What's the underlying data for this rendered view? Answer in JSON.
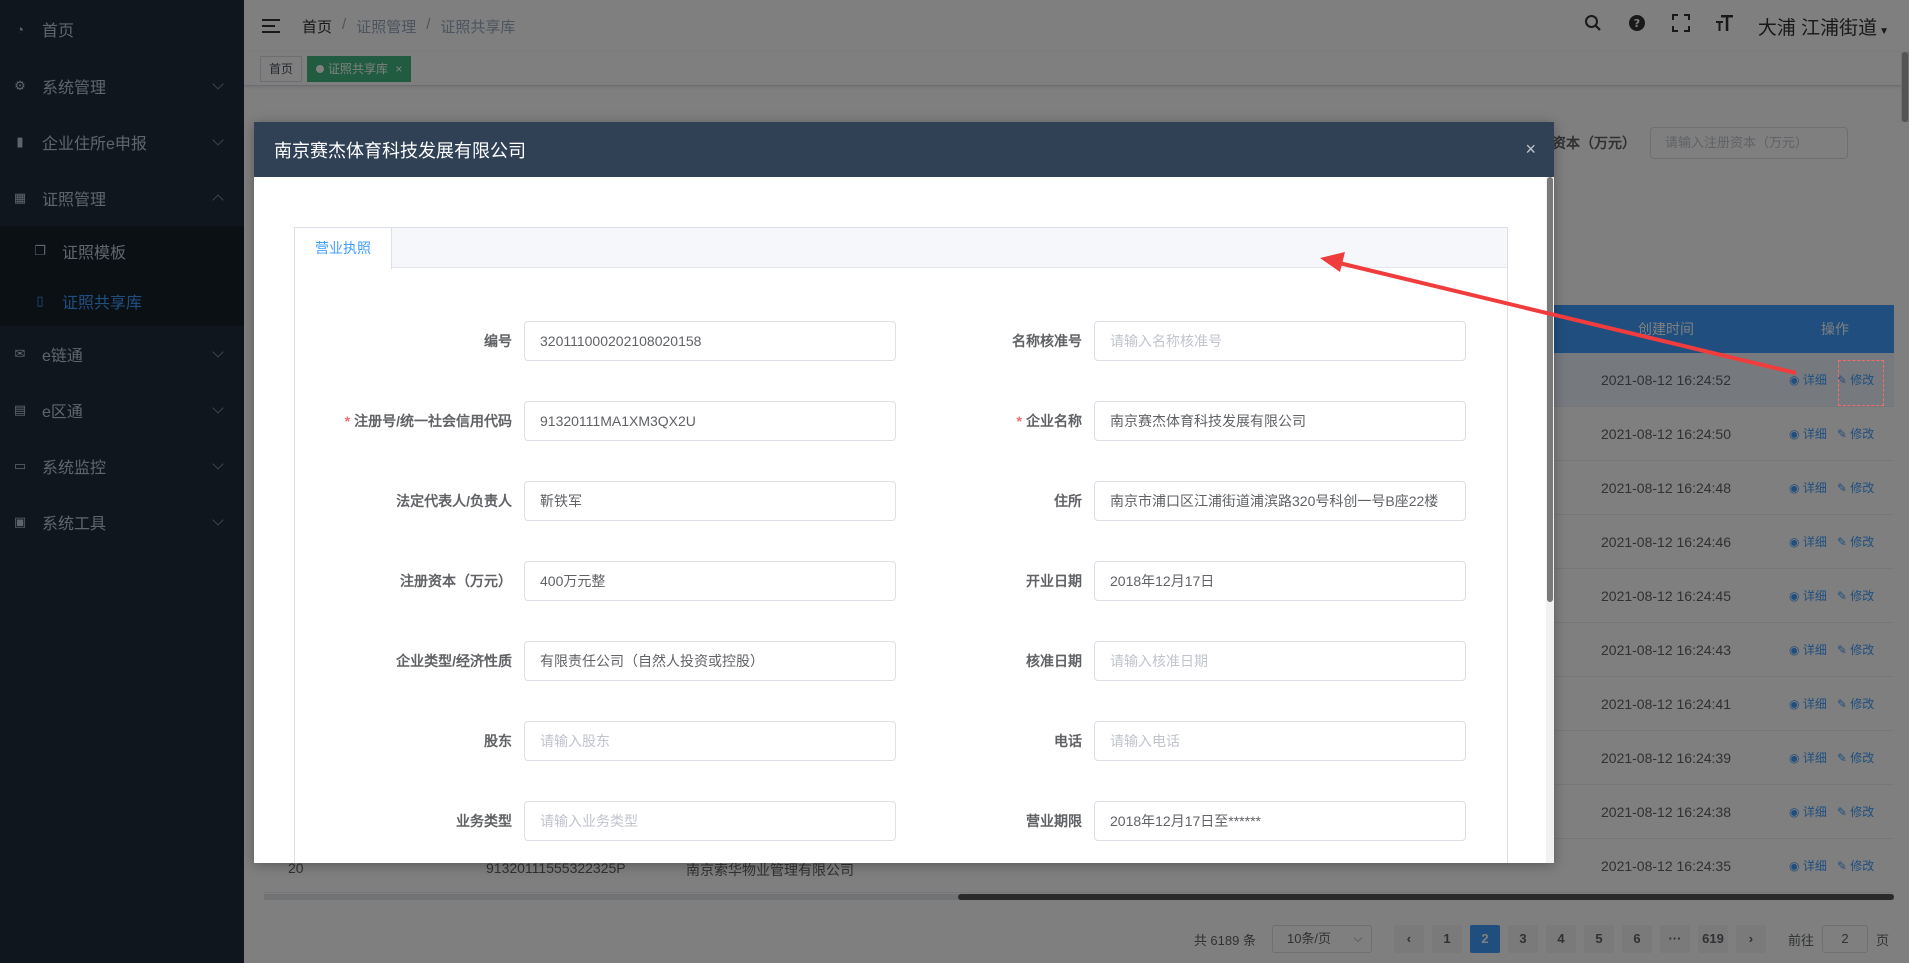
{
  "sidebar": {
    "items": [
      {
        "label": "首页",
        "icon": "dashboard-icon"
      },
      {
        "label": "系统管理",
        "icon": "gear-icon"
      },
      {
        "label": "企业住所e申报",
        "icon": "book-icon"
      },
      {
        "label": "证照管理",
        "icon": "grid-icon"
      },
      {
        "label": "e链通",
        "icon": "mail-icon"
      },
      {
        "label": "e区通",
        "icon": "document-icon"
      },
      {
        "label": "系统监控",
        "icon": "monitor-icon"
      },
      {
        "label": "系统工具",
        "icon": "toolbox-icon"
      }
    ],
    "submenu": [
      {
        "label": "证照模板",
        "icon": "copy-icon"
      },
      {
        "label": "证照共享库",
        "icon": "open-book-icon"
      }
    ]
  },
  "navbar": {
    "breadcrumb": [
      "首页",
      "证照管理",
      "证照共享库"
    ],
    "separator": "/",
    "user": "大浦  江浦街道"
  },
  "tags": {
    "home": "首页",
    "active": "证照共享库",
    "close": "×"
  },
  "background": {
    "filter_label": "资本（万元）",
    "filter_placeholder": "请输入注册资本（万元）",
    "table_headers": {
      "time": "创建时间",
      "ops": "操作"
    },
    "rows": [
      {
        "time": "2021-08-12 16:24:52"
      },
      {
        "time": "2021-08-12 16:24:50"
      },
      {
        "time": "2021-08-12 16:24:48"
      },
      {
        "time": "2021-08-12 16:24:46"
      },
      {
        "time": "2021-08-12 16:24:45"
      },
      {
        "time": "2021-08-12 16:24:43"
      },
      {
        "time": "2021-08-12 16:24:41"
      },
      {
        "time": "2021-08-12 16:24:39"
      },
      {
        "time": "2021-08-12 16:24:38"
      },
      {
        "time": "2021-08-12 16:24:35"
      }
    ],
    "op_detail": "详细",
    "op_edit": "修改",
    "last_row": {
      "index": "20",
      "code": "91320111555322325P",
      "name": "南京索华物业管理有限公司"
    },
    "pagination": {
      "total": "共 6189 条",
      "page_size": "10条/页",
      "pages": [
        "1",
        "2",
        "3",
        "4",
        "5",
        "6",
        "···",
        "619"
      ],
      "current": "2",
      "prev": "‹",
      "next": "›",
      "goto_prefix": "前往",
      "goto_value": "2",
      "goto_suffix": "页"
    }
  },
  "dialog": {
    "title": "南京赛杰体育科技发展有限公司",
    "close": "×",
    "tab": "营业执照",
    "fields_left": [
      {
        "label": "编号",
        "value": "320111000202108020158",
        "placeholder": "",
        "required": false
      },
      {
        "label": "注册号/统一社会信用代码",
        "value": "91320111MA1XM3QX2U",
        "placeholder": "",
        "required": true
      },
      {
        "label": "法定代表人/负责人",
        "value": "靳铁军",
        "placeholder": "",
        "required": false
      },
      {
        "label": "注册资本（万元）",
        "value": "400万元整",
        "placeholder": "",
        "required": false
      },
      {
        "label": "企业类型/经济性质",
        "value": "有限责任公司（自然人投资或控股）",
        "placeholder": "",
        "required": false
      },
      {
        "label": "股东",
        "value": "",
        "placeholder": "请输入股东",
        "required": false
      },
      {
        "label": "业务类型",
        "value": "",
        "placeholder": "请输入业务类型",
        "required": false
      }
    ],
    "fields_right": [
      {
        "label": "名称核准号",
        "value": "",
        "placeholder": "请输入名称核准号",
        "required": false
      },
      {
        "label": "企业名称",
        "value": "南京赛杰体育科技发展有限公司",
        "placeholder": "",
        "required": true
      },
      {
        "label": "住所",
        "value": "南京市浦口区江浦街道浦滨路320号科创一号B座22楼",
        "placeholder": "",
        "required": false
      },
      {
        "label": "开业日期",
        "value": "2018年12月17日",
        "placeholder": "",
        "required": false
      },
      {
        "label": "核准日期",
        "value": "",
        "placeholder": "请输入核准日期",
        "required": false
      },
      {
        "label": "电话",
        "value": "",
        "placeholder": "请输入电话",
        "required": false
      },
      {
        "label": "营业期限",
        "value": "2018年12月17日至******",
        "placeholder": "",
        "required": false
      }
    ]
  },
  "colors": {
    "sidebar_bg": "#1f2d3d",
    "accent": "#409eff",
    "tag_active": "#42b983",
    "dialog_header": "#304156",
    "annotation": "#f03c3c"
  }
}
